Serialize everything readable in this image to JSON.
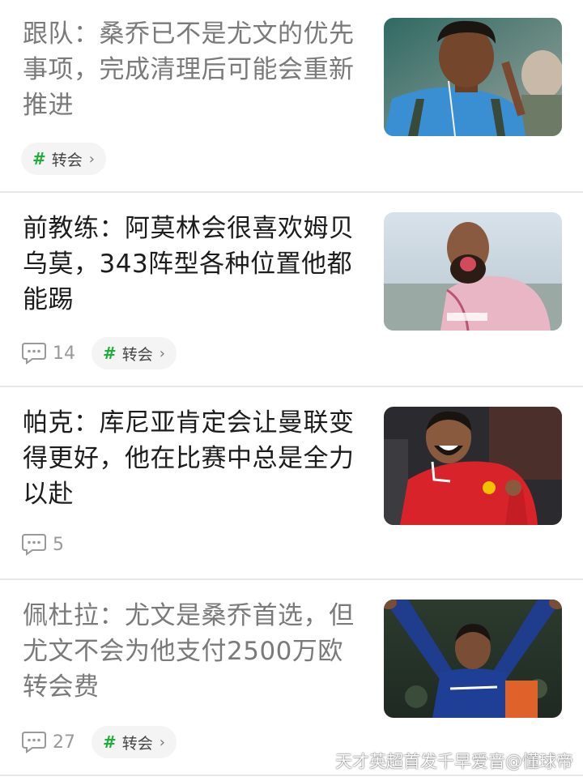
{
  "feed": {
    "items": [
      {
        "title": "跟队：桑乔已不是尤文的优先事项，完成清理后可能会重新推进",
        "read": true,
        "comments": null,
        "tag": "转会",
        "thumb": "player-listening-earphones"
      },
      {
        "title": "前教练：阿莫林会很喜欢姆贝乌莫，343阵型各种位置他都能踢",
        "read": false,
        "comments": "14",
        "tag": "转会",
        "thumb": "bearded-player-celebrating"
      },
      {
        "title": "帕克：库尼亚肯定会让曼联变得更好，他在比赛中总是全力以赴",
        "read": false,
        "comments": "5",
        "tag": null,
        "thumb": "smiling-player-red-jersey"
      },
      {
        "title": "佩杜拉：尤文是桑乔首选，但尤文不会为他支付2500万欧转会费",
        "read": true,
        "comments": "27",
        "tag": "转会",
        "thumb": "player-arms-raised"
      }
    ]
  },
  "tag_chevron": "›",
  "tag_hash": "#",
  "watermark": "天才英超首发千早爱音@懂球帝",
  "colors": {
    "accent_green": "#1fae3a",
    "read_title": "#7a7a7a",
    "unread_title": "#1c1c1c",
    "divider": "#e9e9e9"
  }
}
